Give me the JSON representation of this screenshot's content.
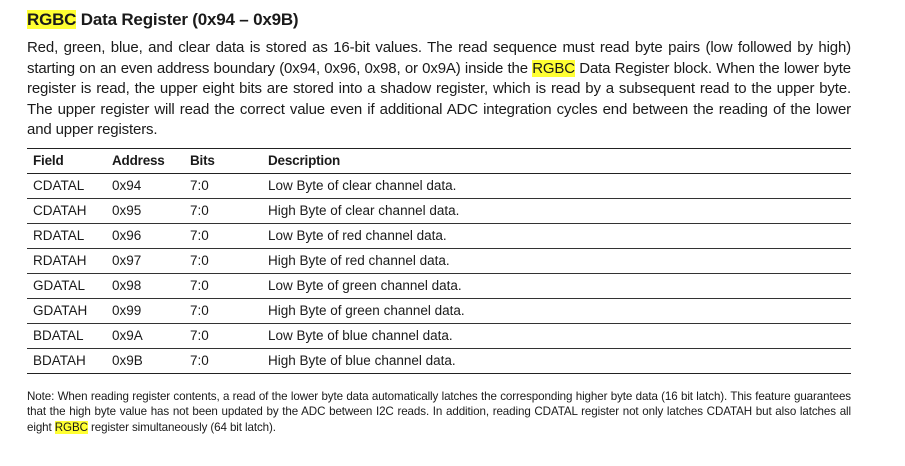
{
  "title": {
    "highlight": "RGBC",
    "rest": " Data Register (0x94 – 0x9B)"
  },
  "intro": {
    "part1": "Red, green, blue, and clear data is stored as 16-bit values. The read sequence must read byte pairs (low followed by high) starting on an even address boundary (0x94, 0x96, 0x98, or 0x9A) inside the ",
    "highlight": "RGBC",
    "part2": " Data Register block. When the lower byte register is read, the upper eight bits are stored into a shadow register, which is read by a subsequent read to the upper byte. The upper register will read the correct value even if additional ADC integration cycles end between the reading of the lower and upper registers."
  },
  "table": {
    "headers": [
      "Field",
      "Address",
      "Bits",
      "Description"
    ],
    "rows": [
      [
        "CDATAL",
        "0x94",
        "7:0",
        "Low Byte of clear channel data."
      ],
      [
        "CDATAH",
        "0x95",
        "7:0",
        "High Byte of clear channel data."
      ],
      [
        "RDATAL",
        "0x96",
        "7:0",
        "Low Byte of red channel data."
      ],
      [
        "RDATAH",
        "0x97",
        "7:0",
        "High Byte of red channel data."
      ],
      [
        "GDATAL",
        "0x98",
        "7:0",
        "Low Byte of green channel data."
      ],
      [
        "GDATAH",
        "0x99",
        "7:0",
        "High Byte of green channel data."
      ],
      [
        "BDATAL",
        "0x9A",
        "7:0",
        "Low Byte of blue channel data."
      ],
      [
        "BDATAH",
        "0x9B",
        "7:0",
        "High Byte of blue channel data."
      ]
    ]
  },
  "note": {
    "part1": "Note: When reading register contents, a read of the lower byte data automatically latches the corresponding higher byte data (16 bit latch). This feature guarantees that the high byte value has not been updated by the ADC between I2C reads. In addition, reading CDATAL register not only latches CDATAH but also latches all eight ",
    "highlight": "RGBC",
    "part2": " register simultaneously (64 bit latch)."
  },
  "colors": {
    "highlight": "#ffff33",
    "text": "#1a1a1a",
    "rule": "#222222"
  }
}
